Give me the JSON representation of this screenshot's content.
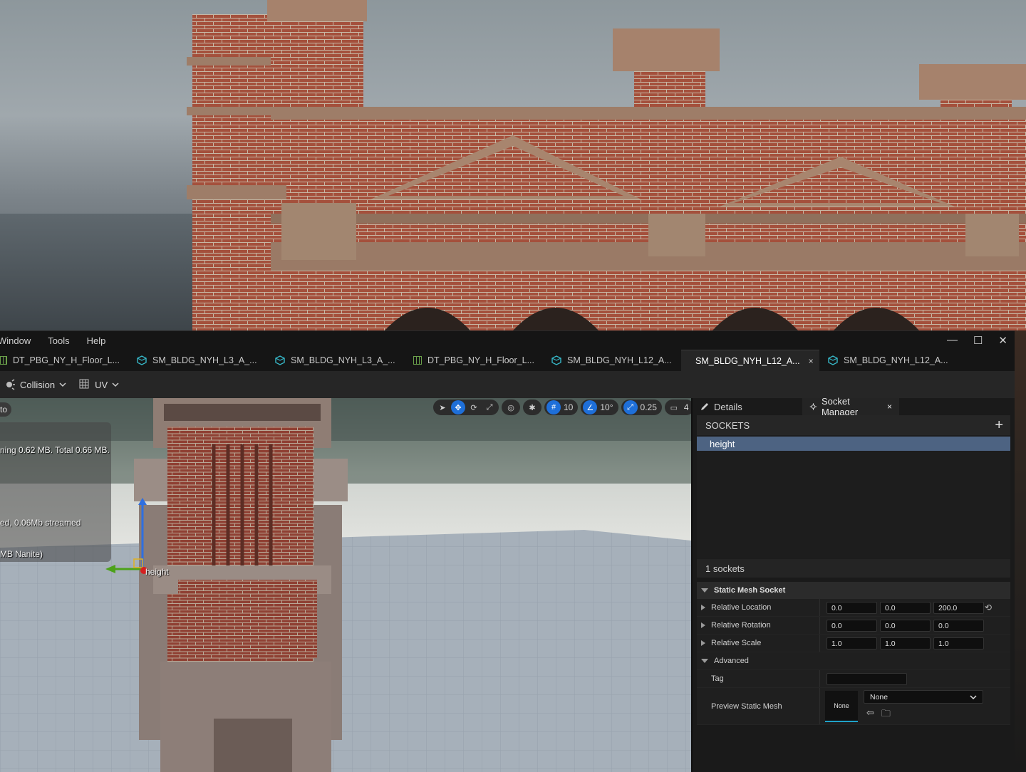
{
  "menu": [
    "Window",
    "Tools",
    "Help"
  ],
  "window_controls": {
    "minimize": "—",
    "maximize": "☐",
    "close": "✕"
  },
  "tabs": [
    {
      "label": "DT_PBG_NY_H_Floor_L...",
      "icon": "data-table-icon",
      "active": false
    },
    {
      "label": "SM_BLDG_NYH_L3_A_...",
      "icon": "static-mesh-icon",
      "active": false
    },
    {
      "label": "SM_BLDG_NYH_L3_A_...",
      "icon": "static-mesh-icon",
      "active": false
    },
    {
      "label": "DT_PBG_NY_H_Floor_L...",
      "icon": "data-table-icon",
      "active": false
    },
    {
      "label": "SM_BLDG_NYH_L12_A...",
      "icon": "static-mesh-icon",
      "active": false
    },
    {
      "label": "SM_BLDG_NYH_L12_A...",
      "icon": "static-mesh-icon",
      "active": true,
      "close": "×"
    },
    {
      "label": "SM_BLDG_NYH_L12_A...",
      "icon": "static-mesh-icon",
      "active": false
    }
  ],
  "toolbar": {
    "collision": "Collision",
    "uv": "UV"
  },
  "viewport": {
    "toggle_label": "to",
    "stats": [
      "ning 0.62 MB. Total 0.66 MB.",
      "ed, 0.06Mb streamed",
      " MB Nanite)"
    ],
    "socket_label": "height",
    "tools": {
      "grid_snap": "10",
      "rotation_snap": "10°",
      "scale_snap": "0.25",
      "camera_speed": "4"
    }
  },
  "panel": {
    "details_tab": "Details",
    "socket_manager_tab": "Socket Manager",
    "close": "×",
    "sockets_header": "SOCKETS",
    "add_button": "+",
    "sockets": [
      "height"
    ],
    "socket_count": "1 sockets",
    "section": "Static Mesh Socket",
    "rows": [
      {
        "label": "Relative Location",
        "values": [
          "0.0",
          "0.0",
          "200.0"
        ],
        "reset": "⟲"
      },
      {
        "label": "Relative Rotation",
        "values": [
          "0.0",
          "0.0",
          "0.0"
        ]
      },
      {
        "label": "Relative Scale",
        "values": [
          "1.0",
          "1.0",
          "1.0"
        ]
      }
    ],
    "advanced": "Advanced",
    "tag_label": "Tag",
    "tag_value": "",
    "preview_label": "Preview Static Mesh",
    "preview_thumb": "None",
    "preview_value": "None"
  }
}
